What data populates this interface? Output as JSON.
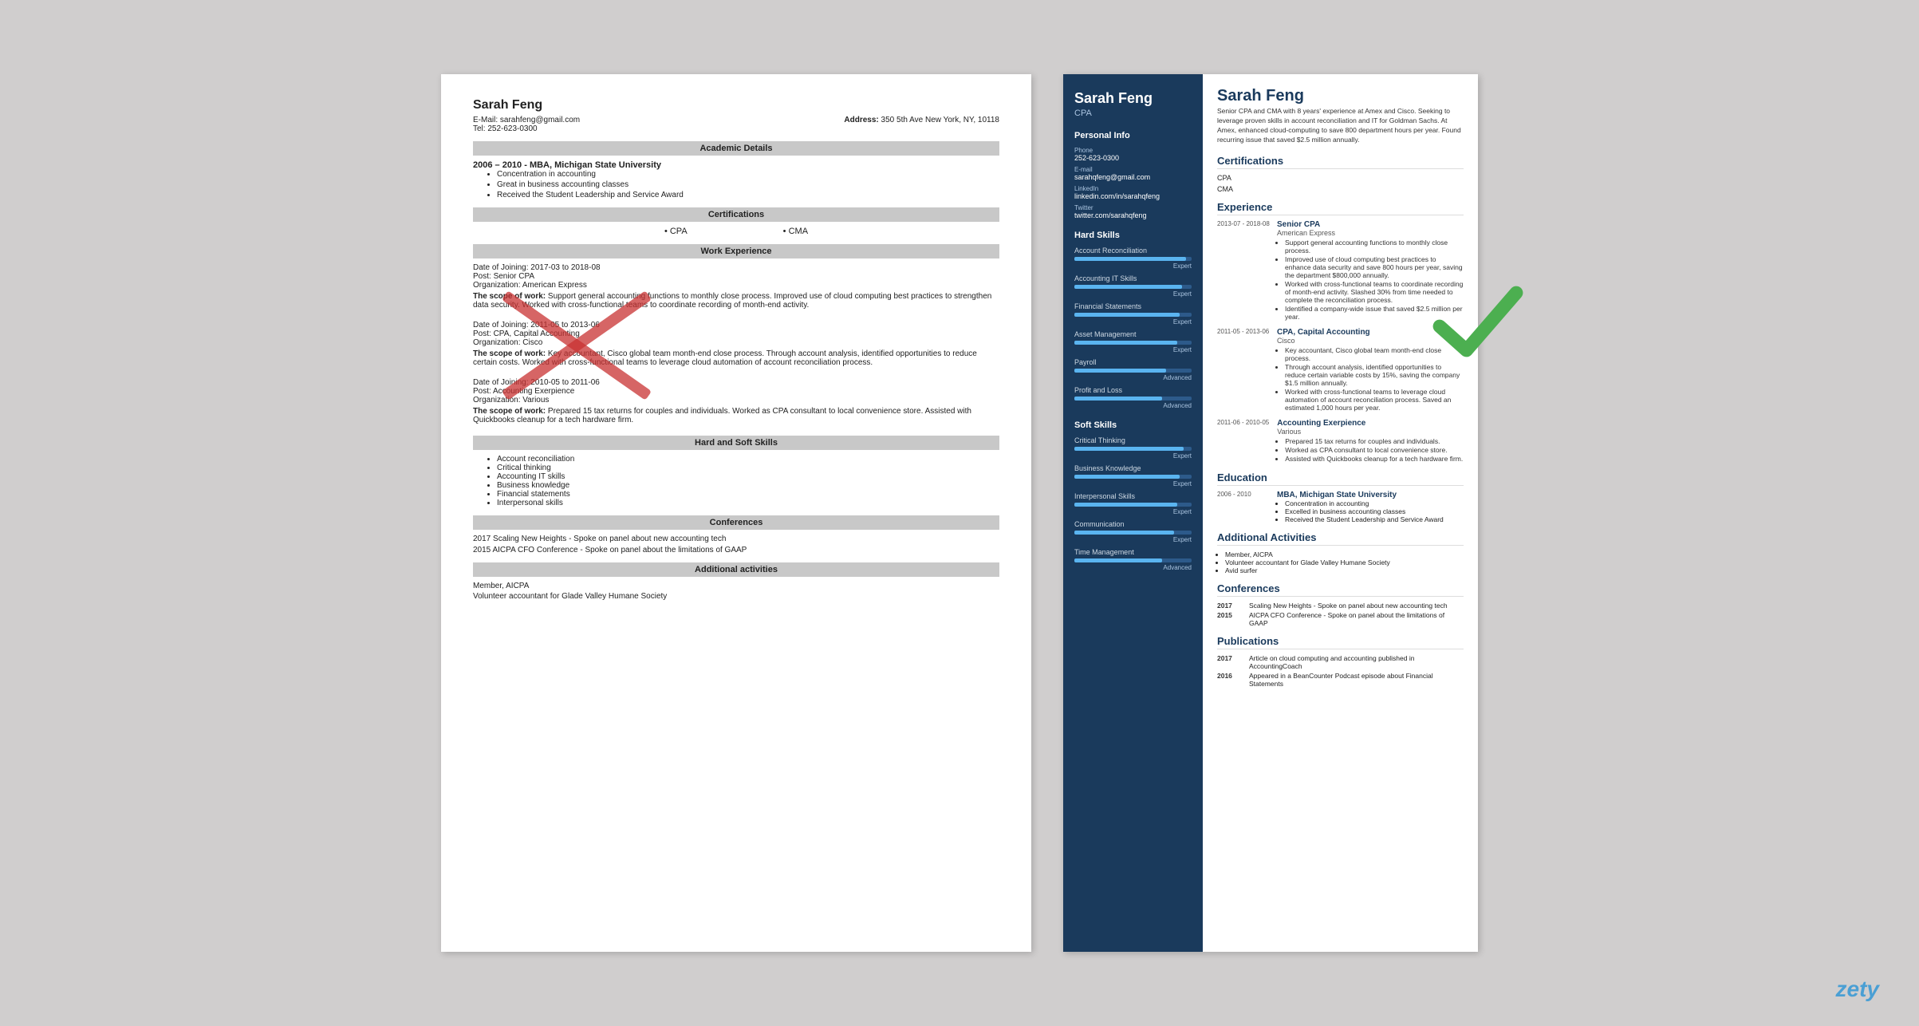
{
  "left_resume": {
    "name": "Sarah Feng",
    "email_label": "E-Mail:",
    "email": "sarahfeng@gmail.com",
    "address_label": "Address:",
    "address": "350 5th Ave New York, NY, 10118",
    "tel_label": "Tel:",
    "tel": "252-623-0300",
    "sections": {
      "academic": "Academic Details",
      "certifications": "Certifications",
      "work_experience": "Work Experience",
      "hard_soft_skills": "Hard and Soft Skills",
      "conferences": "Conferences",
      "additional": "Additional activities"
    },
    "education": {
      "dates": "2006 – 2010 -",
      "degree": "MBA, Michigan State University",
      "bullets": [
        "Concentration in accounting",
        "Great in business accounting classes",
        "Received the Student Leadership and Service Award"
      ]
    },
    "certs": [
      "CPA",
      "CMA"
    ],
    "work": [
      {
        "joining": "Date of Joining: 2017-03 to 2018-08",
        "post": "Post: Senior CPA",
        "org": "Organization: American Express",
        "scope_label": "The scope of work:",
        "scope": "Support general accounting functions to monthly close process. Improved use of cloud computing best practices to strengthen data security. Worked with cross-functional teams to coordinate recording of month-end activity."
      },
      {
        "joining": "Date of Joining: 2011-05 to 2013-06",
        "post": "Post: CPA, Capital Accounting",
        "org": "Organization: Cisco",
        "scope_label": "The scope of work:",
        "scope": "Key accountant, Cisco global team month-end close process. Through account analysis, identified opportunities to reduce certain costs. Worked with cross-functional teams to leverage cloud automation of account reconciliation process."
      },
      {
        "joining": "Date of Joining: 2010-05 to 2011-06",
        "post": "Post: Accounting Exerpience",
        "org": "Organization: Various",
        "scope_label": "The scope of work:",
        "scope": "Prepared 15 tax returns for couples and individuals. Worked as CPA consultant to local convenience store. Assisted with Quickbooks cleanup for a tech hardware firm."
      }
    ],
    "skills": [
      "Account reconciliation",
      "Critical thinking",
      "Accounting IT skills",
      "Business knowledge",
      "Financial statements",
      "Interpersonal skills"
    ],
    "conferences": [
      "2017 Scaling New Heights - Spoke on panel about new accounting tech",
      "2015 AICPA CFO Conference - Spoke on panel about the limitations of GAAP"
    ],
    "additional": [
      "Member, AICPA",
      "Volunteer accountant for Glade Valley Humane Society"
    ]
  },
  "right_resume": {
    "name": "Sarah Feng",
    "title": "CPA",
    "summary": "Senior CPA and CMA with 8 years' experience at Amex and Cisco. Seeking to leverage proven skills in account reconciliation and IT for Goldman Sachs. At Amex, enhanced cloud-computing to save 800 department hours per year. Found recurring issue that saved $2.5 million annually.",
    "sidebar": {
      "personal_info_title": "Personal Info",
      "phone_label": "Phone",
      "phone": "252-623-0300",
      "email_label": "E-mail",
      "email": "sarahqfeng@gmail.com",
      "linkedin_label": "LinkedIn",
      "linkedin": "linkedin.com/in/sarahqfeng",
      "twitter_label": "Twitter",
      "twitter": "twitter.com/sarahqfeng",
      "hard_skills_title": "Hard Skills",
      "hard_skills": [
        {
          "name": "Account Reconciliation",
          "level": "Expert",
          "pct": 95
        },
        {
          "name": "Accounting IT Skills",
          "level": "Expert",
          "pct": 92
        },
        {
          "name": "Financial Statements",
          "level": "Expert",
          "pct": 90
        },
        {
          "name": "Asset Management",
          "level": "Expert",
          "pct": 88
        },
        {
          "name": "Payroll",
          "level": "Advanced",
          "pct": 78
        },
        {
          "name": "Profit and Loss",
          "level": "Advanced",
          "pct": 75
        }
      ],
      "soft_skills_title": "Soft Skills",
      "soft_skills": [
        {
          "name": "Critical Thinking",
          "level": "Expert",
          "pct": 93
        },
        {
          "name": "Business Knowledge",
          "level": "Expert",
          "pct": 90
        },
        {
          "name": "Interpersonal Skills",
          "level": "Expert",
          "pct": 88
        },
        {
          "name": "Communication",
          "level": "Expert",
          "pct": 85
        },
        {
          "name": "Time Management",
          "level": "Advanced",
          "pct": 75
        }
      ]
    },
    "certifications_title": "Certifications",
    "certifications": [
      "CPA",
      "CMA"
    ],
    "experience_title": "Experience",
    "experience": [
      {
        "dates": "2013-07 -\n2018-08",
        "title": "Senior CPA",
        "org": "American Express",
        "bullets": [
          "Support general accounting functions to monthly close process.",
          "Improved use of cloud computing best practices to enhance data security and save 800 hours per year, saving the department $800,000 annually.",
          "Worked with cross-functional teams to coordinate recording of month-end activity. Slashed 30% from time needed to complete the reconciliation process.",
          "Identified a company-wide issue that saved $2.5 million per year."
        ]
      },
      {
        "dates": "2011-05 -\n2013-06",
        "title": "CPA, Capital Accounting",
        "org": "Cisco",
        "bullets": [
          "Key accountant, Cisco global team month-end close process.",
          "Through account analysis, identified opportunities to reduce certain variable costs by 15%, saving the company $1.5 million annually.",
          "Worked with cross-functional teams to leverage cloud automation of account reconciliation process. Saved an estimated 1,000 hours per year."
        ]
      },
      {
        "dates": "2011-06 -\n2010-05",
        "title": "Accounting Exerpience",
        "org": "Various",
        "bullets": [
          "Prepared 15 tax returns for couples and individuals.",
          "Worked as CPA consultant to local convenience store.",
          "Assisted with Quickbooks cleanup for a tech hardware firm."
        ]
      }
    ],
    "education_title": "Education",
    "education": {
      "dates": "2006 -\n2010",
      "degree": "MBA, Michigan State University",
      "bullets": [
        "Concentration in accounting",
        "Excelled in business accounting classes",
        "Received the Student Leadership and Service Award"
      ]
    },
    "additional_title": "Additional Activities",
    "additional": [
      "Member, AICPA",
      "Volunteer accountant for Glade Valley Humane Society",
      "Avid surfer"
    ],
    "conferences_title": "Conferences",
    "conferences": [
      {
        "year": "2017",
        "text": "Scaling New Heights - Spoke on panel about new accounting tech"
      },
      {
        "year": "2015",
        "text": "AICPA CFO Conference - Spoke on panel about the limitations of GAAP"
      }
    ],
    "publications_title": "Publications",
    "publications": [
      {
        "year": "2017",
        "text": "Article on cloud computing and accounting published in AccountingCoach"
      },
      {
        "year": "2016",
        "text": "Appeared in a BeanCounter Podcast episode about Financial Statements"
      }
    ]
  },
  "watermark": "zety"
}
